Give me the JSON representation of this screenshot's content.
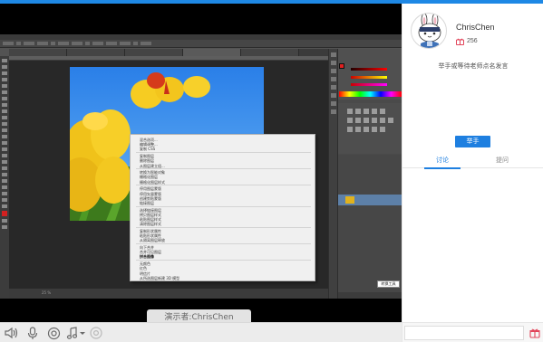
{
  "colors": {
    "accent": "#1e7fe0",
    "flower": "#e2455b"
  },
  "sidebar": {
    "username": "ChrisChen",
    "flower_count": "256",
    "notice": "举手或等待老师点名发言",
    "raise_hand_label": "举手",
    "tabs": [
      {
        "label": "讨论",
        "active": true
      },
      {
        "label": "提问",
        "active": false
      }
    ],
    "chat_placeholder": ""
  },
  "stage": {
    "presenter_label": "演示者:ChrisChen",
    "tooltip": "转换工具",
    "zoom": "25 %",
    "context_menu": [
      "混合选项...",
      "编辑调整...",
      "复制 CSS",
      "复制图层",
      "删除图层",
      "从图层建立组...",
      "转换为智能对象",
      "栅格化图层",
      "栅格化图层样式",
      "停用图层蒙版",
      "停用矢量蒙版",
      "创建剪贴蒙版",
      "链接图层",
      "选择链接图层",
      "拷贝图层样式",
      "粘贴图层样式",
      "清除图层样式",
      "复制形状属性",
      "粘贴形状属性",
      "从隔离图层释放",
      "向下合并",
      "合并可见图层",
      "拼合图像",
      "无颜色",
      "红色",
      "明信片",
      "从所选图层新建 3D 模型"
    ]
  },
  "controls": {
    "icons": [
      "speaker-icon",
      "microphone-icon",
      "camera-icon",
      "music-icon",
      "record-icon"
    ]
  }
}
